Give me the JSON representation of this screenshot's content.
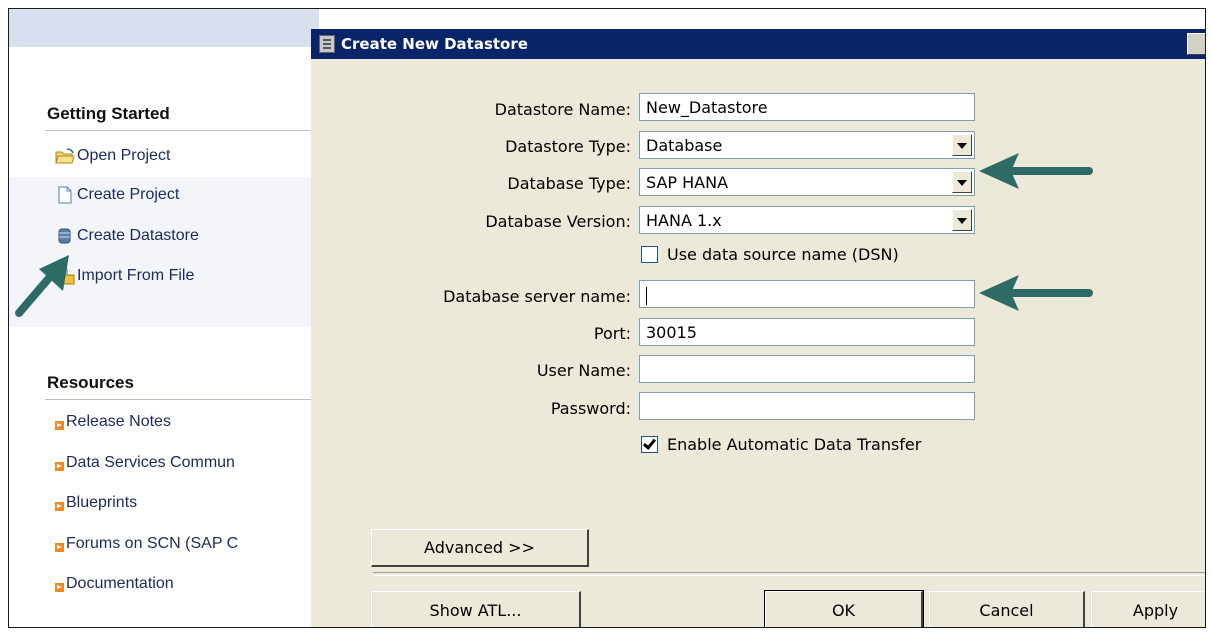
{
  "left_panel": {
    "getting_started": {
      "title": "Getting Started",
      "items": [
        {
          "label": "Open Project",
          "icon": "folder-open-icon"
        },
        {
          "label": "Create Project",
          "icon": "document-icon"
        },
        {
          "label": "Create Datastore",
          "icon": "database-icon"
        },
        {
          "label": "Import From File",
          "icon": "import-file-icon"
        }
      ]
    },
    "resources": {
      "title": "Resources",
      "items": [
        {
          "label": "Release Notes"
        },
        {
          "label": "Data Services Commun"
        },
        {
          "label": "Blueprints"
        },
        {
          "label": "Forums on SCN (SAP C"
        },
        {
          "label": "Documentation"
        }
      ]
    }
  },
  "dialog": {
    "title": "Create New Datastore",
    "fields": {
      "datastore_name": {
        "label": "Datastore Name:",
        "value": "New_Datastore"
      },
      "datastore_type": {
        "label": "Datastore Type:",
        "value": "Database"
      },
      "database_type": {
        "label": "Database Type:",
        "value": "SAP HANA"
      },
      "database_version": {
        "label": "Database Version:",
        "value": "HANA 1.x"
      },
      "use_dsn": {
        "label": "Use data source name (DSN)",
        "checked": false
      },
      "server_name": {
        "label": "Database server name:",
        "value": ""
      },
      "port": {
        "label": "Port:",
        "value": "30015"
      },
      "user_name": {
        "label": "User Name:",
        "value": ""
      },
      "password": {
        "label": "Password:",
        "value": ""
      },
      "auto_transfer": {
        "label": "Enable Automatic Data Transfer",
        "checked": true
      }
    },
    "buttons": {
      "advanced": "Advanced >>",
      "show_atl": "Show ATL...",
      "ok": "OK",
      "cancel": "Cancel",
      "apply": "Apply"
    }
  },
  "colors": {
    "titlebar": "#0a246a",
    "dialog_bg": "#ece9d8",
    "arrow": "#2e6b67",
    "bullet": "#f08a24"
  }
}
